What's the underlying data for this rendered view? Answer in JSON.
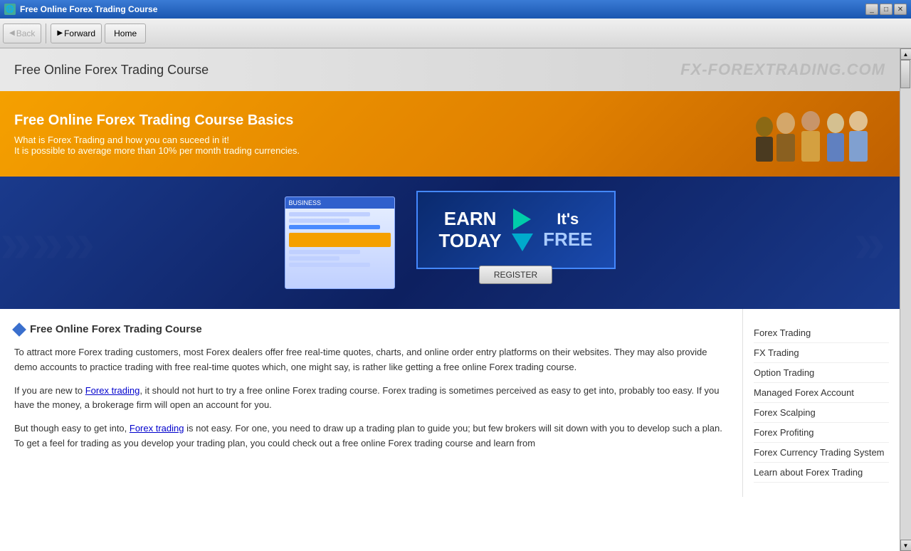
{
  "window": {
    "title": "Free Online Forex Trading Course",
    "icon": "🌐"
  },
  "toolbar": {
    "back_label": "Back",
    "forward_label": "Forward",
    "home_label": "Home",
    "back_disabled": true,
    "forward_disabled": false
  },
  "site": {
    "header_title": "Free Online Forex Trading Course",
    "domain": "FX-FOREXTRADING.COM",
    "hero_title": "Free Online Forex Trading Course Basics",
    "hero_subtitle_1": "What is Forex Trading and how you can suceed in it!",
    "hero_subtitle_2": "It is possible to average more than 10% per month trading currencies.",
    "earn_today": "EARN\nTODAY",
    "its_free": "It's\nFREE",
    "register_label": "REGISTER"
  },
  "article": {
    "heading": "Free Online Forex Trading Course",
    "paragraph1": "To attract more Forex trading customers, most Forex dealers offer free real-time quotes, charts, and online order entry platforms on their websites. They may also provide demo accounts to practice trading with free real-time quotes which, one might say, is rather like getting a free online Forex trading course.",
    "paragraph2": "If you are new to Forex trading, it should not hurt to try a free online Forex trading course. Forex trading is sometimes perceived as easy to get into, probably too easy. If you have the money, a brokerage firm will open an account for you.",
    "paragraph3": "But though easy to get into, Forex trading is not easy. For one, you need to draw up a trading plan to guide you; but few brokers will sit down with you to develop such a plan. To get a feel for trading as you develop your trading plan, you could check out a free online Forex trading course and learn from",
    "link1": "Forex trading",
    "link2": "Forex trading"
  },
  "sidebar": {
    "links": [
      "Forex Trading",
      "FX Trading",
      "Option Trading",
      "Managed Forex Account",
      "Forex Scalping",
      "Forex Profiting",
      "Forex Currency Trading System",
      "Learn about Forex Trading"
    ]
  }
}
